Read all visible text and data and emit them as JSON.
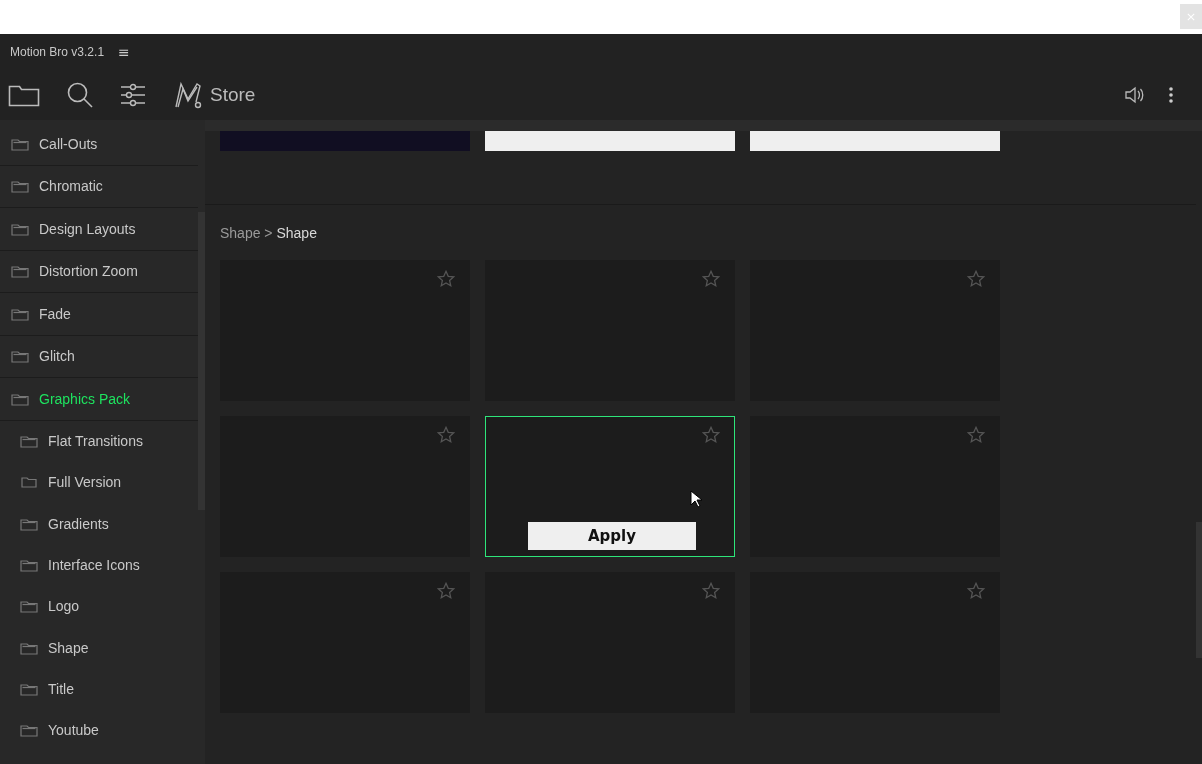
{
  "app": {
    "title": "Motion Bro v3.2.1",
    "menu_glyph": "≡",
    "store_label": "Store"
  },
  "sidebar": {
    "items": [
      {
        "label": "Call-Outs",
        "selected": false
      },
      {
        "label": "Chromatic",
        "selected": false
      },
      {
        "label": "Design Layouts",
        "selected": false
      },
      {
        "label": "Distortion Zoom",
        "selected": false
      },
      {
        "label": "Fade",
        "selected": false
      },
      {
        "label": "Glitch",
        "selected": false
      },
      {
        "label": "Graphics Pack",
        "selected": true,
        "children": [
          {
            "label": "Flat Transitions",
            "kind": "open-folder"
          },
          {
            "label": "Full Version",
            "kind": "folder"
          },
          {
            "label": "Gradients",
            "kind": "open-folder"
          },
          {
            "label": "Interface Icons",
            "kind": "open-folder"
          },
          {
            "label": "Logo",
            "kind": "open-folder"
          },
          {
            "label": "Shape",
            "kind": "open-folder"
          },
          {
            "label": "Title",
            "kind": "open-folder"
          },
          {
            "label": "Youtube",
            "kind": "open-folder"
          }
        ]
      }
    ]
  },
  "previous_section": {
    "thumbnails": [
      {
        "color": "#110e22"
      },
      {
        "color": "#efefef"
      },
      {
        "color": "#efefef"
      }
    ]
  },
  "section": {
    "breadcrumb_parent": "Shape",
    "breadcrumb_separator": ">",
    "breadcrumb_current": "Shape",
    "cards": [
      {
        "hovered": false,
        "favorite": false
      },
      {
        "hovered": false,
        "favorite": false
      },
      {
        "hovered": false,
        "favorite": false
      },
      {
        "hovered": false,
        "favorite": false
      },
      {
        "hovered": true,
        "favorite": false,
        "button": "Apply"
      },
      {
        "hovered": false,
        "favorite": false
      },
      {
        "hovered": false,
        "favorite": false
      },
      {
        "hovered": false,
        "favorite": false
      },
      {
        "hovered": false,
        "favorite": false
      }
    ]
  }
}
